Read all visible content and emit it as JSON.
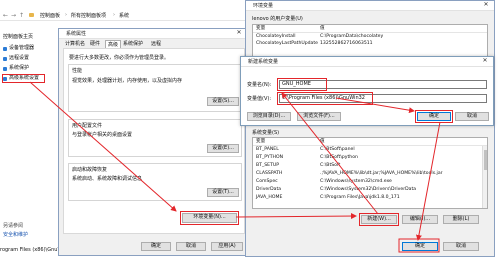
{
  "explorer": {
    "breadcrumb": [
      "控制面板",
      "所有控制面板项",
      "系统"
    ],
    "sidebar_title": "控制面板主页",
    "sidebar": [
      "设备管理器",
      "远程设置",
      "系统保护",
      "高级系统设置"
    ],
    "see_also": "另请参阅",
    "security": "安全和维护",
    "status_text": "rogram Files (x86)\\GnuWin32"
  },
  "sysprops": {
    "title": "系统属性",
    "tabs": [
      "计算机名",
      "硬件",
      "高级",
      "系统保护",
      "远程"
    ],
    "note": "要进行大多数更改，你必须作为管理员登录。",
    "perf": {
      "title": "性能",
      "desc": "视觉效果，处理器计划，内存使用，以及虚拟内存",
      "button": "设置(S)..."
    },
    "profile": {
      "title": "用户配置文件",
      "desc": "与登录帐户相关的桌面设置",
      "button": "设置(E)..."
    },
    "startup": {
      "title": "启动和故障恢复",
      "desc": "系统启动、系统故障和调试信息",
      "button": "设置(T)..."
    },
    "env_button": "环境变量(N)...",
    "ok": "确定",
    "cancel": "取消",
    "apply": "应用(A)"
  },
  "envvars": {
    "title": "环境变量",
    "user_section": "lenovo 的用户变量(U)",
    "col_var": "变量",
    "col_val": "值",
    "user_rows": [
      [
        "ChocolateyInstall",
        "C:\\ProgramData\\chocolatey"
      ],
      [
        "ChocolateyLastPathUpdate",
        "132552862716063511"
      ]
    ],
    "sys_section": "系统变量(S)",
    "sys_rows": [
      [
        "变量",
        "值"
      ],
      [
        "BT_PANEL",
        "C:\\BtSoft\\panel"
      ],
      [
        "BT_PYTHON",
        "C:\\BtSoft\\python"
      ],
      [
        "BT_SETUP",
        "C:\\BtSoft"
      ],
      [
        "CLASSPATH",
        ".;%JAVA_HOME%\\lib\\dt.jar;%JAVA_HOME%\\lib\\tools.jar"
      ],
      [
        "ComSpec",
        "C:\\Windows\\system32\\cmd.exe"
      ],
      [
        "DriverData",
        "C:\\Windows\\System32\\Drivers\\DriverData"
      ],
      [
        "JAVA_HOME",
        "C:\\Program Files\\Java\\jdk1.8.0_171"
      ]
    ],
    "new_button": "新建(W)...",
    "edit_button": "编辑(I)...",
    "delete_button": "删除(L)",
    "ok": "确定",
    "cancel": "取消"
  },
  "newvar": {
    "title": "新建系统变量",
    "name_label": "变量名(N):",
    "name_value": "GNU_HOME",
    "value_label": "变量值(V):",
    "value_value": "C:\\Program Files (x86)\\GnuWin32",
    "browse_dir": "浏览目录(D)...",
    "browse_file": "浏览文件(F)...",
    "ok": "确定",
    "cancel": "取消"
  },
  "colors": {
    "highlight": "#e3262b",
    "selection": "#cce8ff",
    "accent": "#0078d7"
  }
}
